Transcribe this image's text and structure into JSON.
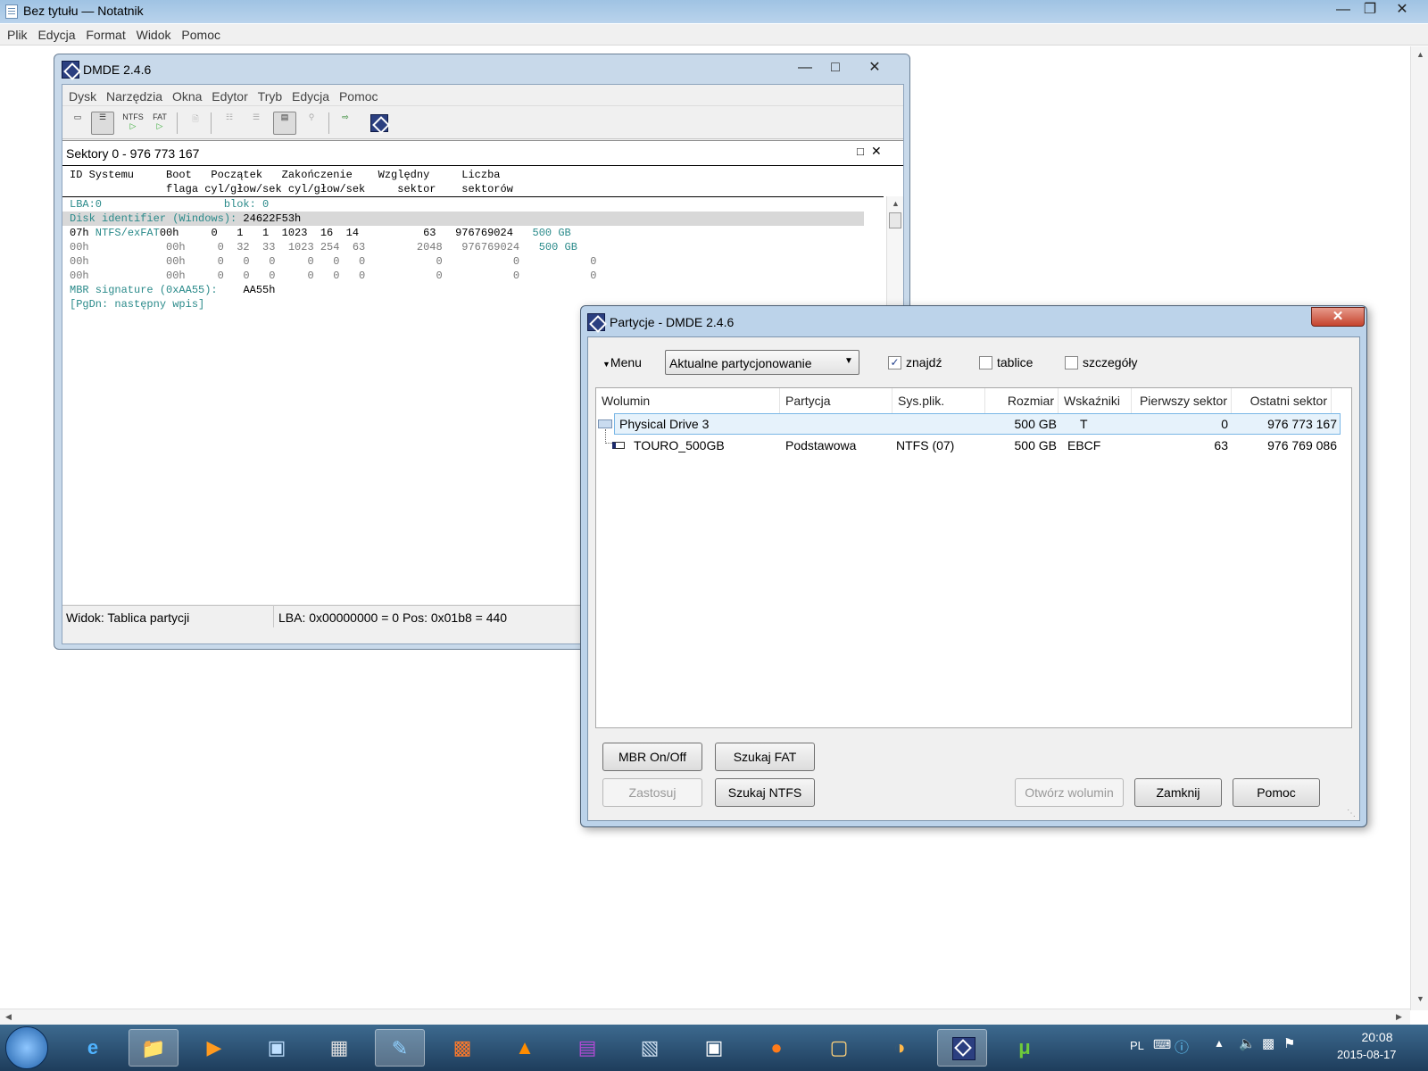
{
  "notepad": {
    "title": "Bez tytułu — Notatnik",
    "menu": [
      "Plik",
      "Edycja",
      "Format",
      "Widok",
      "Pomoc"
    ]
  },
  "dmde": {
    "title": "DMDE 2.4.6",
    "menu": [
      "Dysk",
      "Narzędzia",
      "Okna",
      "Edytor",
      "Tryb",
      "Edycja",
      "Pomoc"
    ],
    "toolbar": {
      "ntfs": "NTFS",
      "fat": "FAT"
    },
    "pane_title": "Sektory 0 - 976 773 167",
    "col_header_1": "ID Systemu     Boot   Początek   Zakończenie    Względny     Liczba",
    "col_header_2": "               flaga cyl/głow/sek cyl/głow/sek     sektor    sektorów",
    "lines": {
      "lba": "LBA:0                   blok: 0",
      "diskid_label": "Disk identifier (Windows):",
      "diskid_value": " 24622F53h",
      "p1_id": "07h",
      "p1_fs": " NTFS/exFAT",
      "p1_vals": "00h     0   1   1  1023  16  14          63   976769024",
      "p1_size": "   500 GB",
      "p2_vals": "00h            00h     0  32  33  1023 254  63        2048   976769024",
      "p2_size": "   500 GB",
      "p3": "00h            00h     0   0   0     0   0   0           0           0           0",
      "p4": "00h            00h     0   0   0     0   0   0           0           0           0",
      "sig_label": "MBR signature (0xAA55):",
      "sig_value": "    AA55h",
      "next": "[PgDn: następny wpis]"
    },
    "status": {
      "view": "Widok: Tablica partycji",
      "pos": "LBA: 0x00000000 = 0  Pos: 0x01b8 = 440"
    }
  },
  "partitions": {
    "title": "Partycje - DMDE 2.4.6",
    "close": "✕",
    "menu_label": "Menu",
    "dropdown_value": "Aktualne partycjonowanie",
    "checkboxes": [
      {
        "label": "znajdź",
        "checked": true
      },
      {
        "label": "tablice",
        "checked": false
      },
      {
        "label": "szczegóły",
        "checked": false
      }
    ],
    "columns": [
      "Wolumin",
      "Partycja",
      "Sys.plik.",
      "Rozmiar",
      "Wskaźniki",
      "Pierwszy sektor",
      "Ostatni sektor"
    ],
    "rows": [
      {
        "volume": "Physical Drive 3",
        "partition": "",
        "fs": "",
        "size": "500 GB",
        "flags": "T",
        "first": "0",
        "last": "976 773 167"
      },
      {
        "volume": "TOURO_500GB",
        "partition": "Podstawowa",
        "fs": "NTFS (07)",
        "size": "500 GB",
        "flags": "EBCF",
        "first": "63",
        "last": "976 769 086"
      }
    ],
    "buttons": {
      "mbr": "MBR On/Off",
      "fat": "Szukaj FAT",
      "apply": "Zastosuj",
      "ntfs": "Szukaj NTFS",
      "open": "Otwórz wolumin",
      "close": "Zamknij",
      "help": "Pomoc"
    }
  },
  "taskbar": {
    "lang": "PL",
    "time": "20:08",
    "date": "2015-08-17"
  }
}
